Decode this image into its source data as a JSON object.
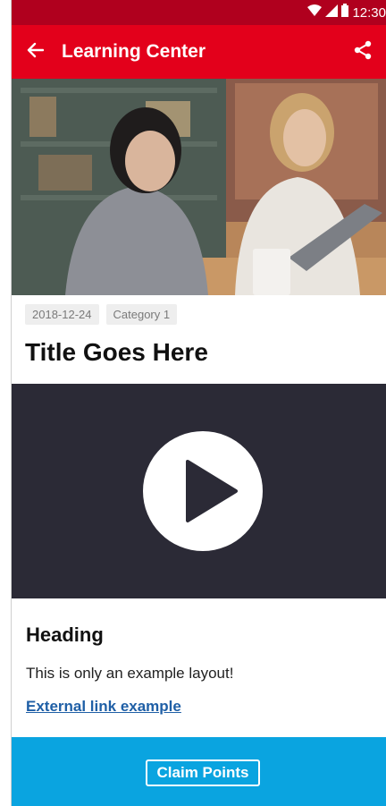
{
  "status_bar": {
    "time": "12:30"
  },
  "app_bar": {
    "title": "Learning Center"
  },
  "article": {
    "date": "2018-12-24",
    "category": "Category 1",
    "title": "Title Goes Here",
    "heading": "Heading",
    "body": "This is only an example layout!",
    "link_text": "External link example"
  },
  "footer": {
    "button_label": "Claim Points"
  },
  "colors": {
    "status_bar": "#b0001e",
    "app_bar": "#e3001b",
    "video_bg": "#2b2a36",
    "footer": "#0aa4e0",
    "link": "#1f5fa6"
  },
  "icons": {
    "back": "arrow-left-icon",
    "share": "share-icon",
    "play": "play-icon",
    "wifi": "wifi-icon",
    "signal": "signal-icon",
    "battery": "battery-icon"
  }
}
